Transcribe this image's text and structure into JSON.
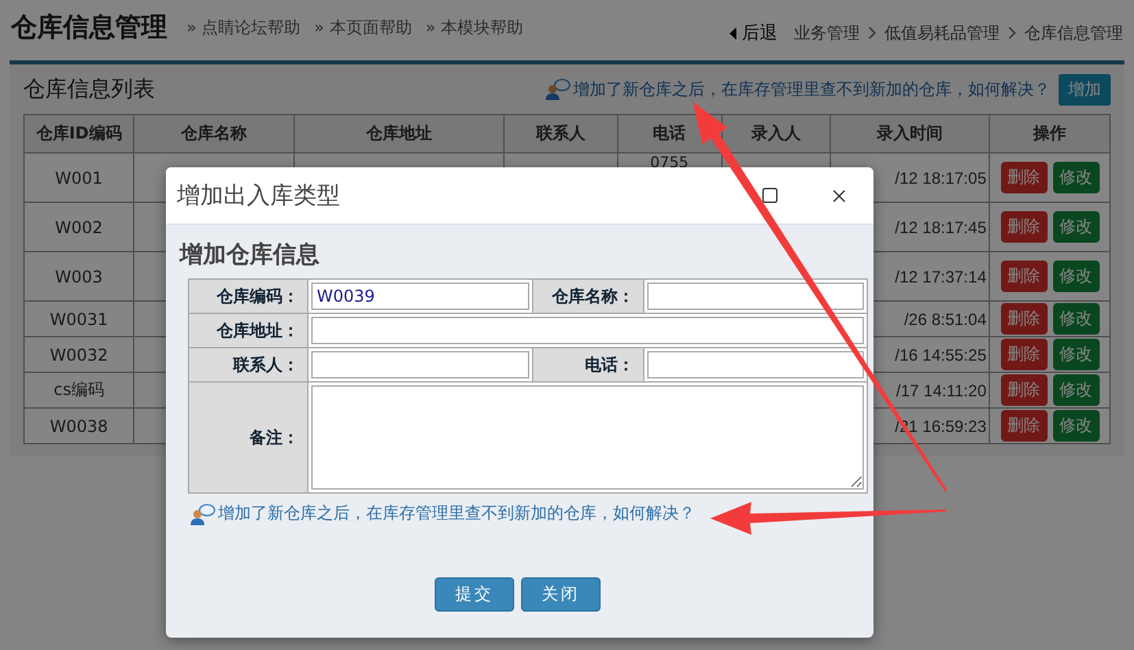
{
  "page": {
    "title": "仓库信息管理",
    "help_links": [
      "» 点睛论坛帮助",
      "» 本页面帮助",
      "» 本模块帮助"
    ],
    "back": "后退",
    "breadcrumb": [
      "业务管理",
      "低值易耗品管理",
      "仓库信息管理"
    ]
  },
  "panel": {
    "title": "仓库信息列表",
    "help": "增加了新仓库之后，在库存管理里查不到新加的仓库，如何解决？",
    "add_button": "增加"
  },
  "table": {
    "columns": [
      "仓库ID编码",
      "仓库名称",
      "仓库地址",
      "联系人",
      "电话",
      "录入人",
      "录入时间",
      "操作"
    ],
    "rows": [
      {
        "id": "W001",
        "phone": "0755",
        "time": "/12 18:17:05",
        "actions": [
          "删除",
          "修改"
        ]
      },
      {
        "id": "W002",
        "time": "/12 18:17:45",
        "actions": [
          "删除",
          "修改"
        ]
      },
      {
        "id": "W003",
        "time": "/12 17:37:14",
        "actions": [
          "删除",
          "修改"
        ]
      },
      {
        "id": "W0031",
        "time": "/26 8:51:04",
        "actions": [
          "删除",
          "修改"
        ]
      },
      {
        "id": "W0032",
        "time": "/16 14:55:25",
        "actions": [
          "删除",
          "修改"
        ]
      },
      {
        "id": "cs编码",
        "time": "/17 14:11:20",
        "actions": [
          "删除",
          "修改"
        ]
      },
      {
        "id": "W0038",
        "time": "/21 16:59:23",
        "actions": [
          "删除",
          "修改"
        ]
      }
    ]
  },
  "dialog": {
    "title": "增加出入库类型",
    "heading": "增加仓库信息",
    "rows": [
      [
        {
          "label": "仓库编码：",
          "value": "W0039",
          "kind": "text"
        },
        {
          "label": "仓库名称：",
          "kind": "text"
        }
      ],
      [
        {
          "label": "仓库地址：",
          "kind": "text"
        }
      ],
      [
        {
          "label": "联系人：",
          "kind": "text"
        },
        {
          "label": "电话：",
          "kind": "text"
        }
      ],
      [
        {
          "label": "备注：",
          "kind": "textarea"
        }
      ]
    ],
    "help": "增加了新仓库之后，在库存管理里查不到新加的仓库，如何解决？",
    "buttons": [
      "提交",
      "关闭"
    ]
  }
}
